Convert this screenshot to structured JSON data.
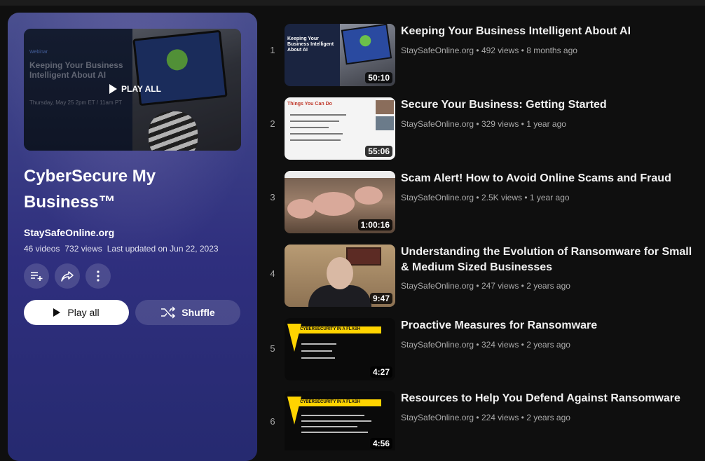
{
  "playlist": {
    "hero": {
      "tiny_label": "Webinar",
      "title": "Keeping Your Business Intelligent About AI",
      "date": "Thursday, May 25 2pm ET / 11am PT",
      "play_all_label": "PLAY ALL"
    },
    "title": "CyberSecure My Business™",
    "channel": "StaySafeOnline.org",
    "video_count": "46 videos",
    "views": "732 views",
    "updated": "Last updated on Jun 22, 2023",
    "actions": {
      "save_icon": "playlist-add-icon",
      "share_icon": "share-icon",
      "more_icon": "more-vert-icon"
    },
    "play_all_button": "Play all",
    "shuffle_button": "Shuffle"
  },
  "videos": [
    {
      "index": "1",
      "title": "Keeping Your Business Intelligent About AI",
      "channel": "StaySafeOnline.org",
      "views": "492 views",
      "age": "8 months ago",
      "duration": "50:10"
    },
    {
      "index": "2",
      "title": "Secure Your Business: Getting Started",
      "channel": "StaySafeOnline.org",
      "views": "329 views",
      "age": "1 year ago",
      "duration": "55:06",
      "thumb_heading": "Things You Can Do"
    },
    {
      "index": "3",
      "title": "Scam Alert! How to Avoid Online Scams and Fraud",
      "channel": "StaySafeOnline.org",
      "views": "2.5K views",
      "age": "1 year ago",
      "duration": "1:00:16"
    },
    {
      "index": "4",
      "title": "Understanding the Evolution of Ransomware for Small & Medium Sized Businesses",
      "channel": "StaySafeOnline.org",
      "views": "247 views",
      "age": "2 years ago",
      "duration": "9:47"
    },
    {
      "index": "5",
      "title": "Proactive Measures for Ransomware",
      "channel": "StaySafeOnline.org",
      "views": "324 views",
      "age": "2 years ago",
      "duration": "4:27",
      "thumb_heading": "CYBERSECURITY IN A FLASH"
    },
    {
      "index": "6",
      "title": "Resources to Help You Defend Against Ransomware",
      "channel": "StaySafeOnline.org",
      "views": "224 views",
      "age": "2 years ago",
      "duration": "4:56",
      "thumb_heading": "CYBERSECURITY IN A FLASH"
    }
  ],
  "separator": "•",
  "colors": {
    "background": "#0f0f0f",
    "panel": "#2f2f7e",
    "meta_text": "#aaaaaa"
  }
}
